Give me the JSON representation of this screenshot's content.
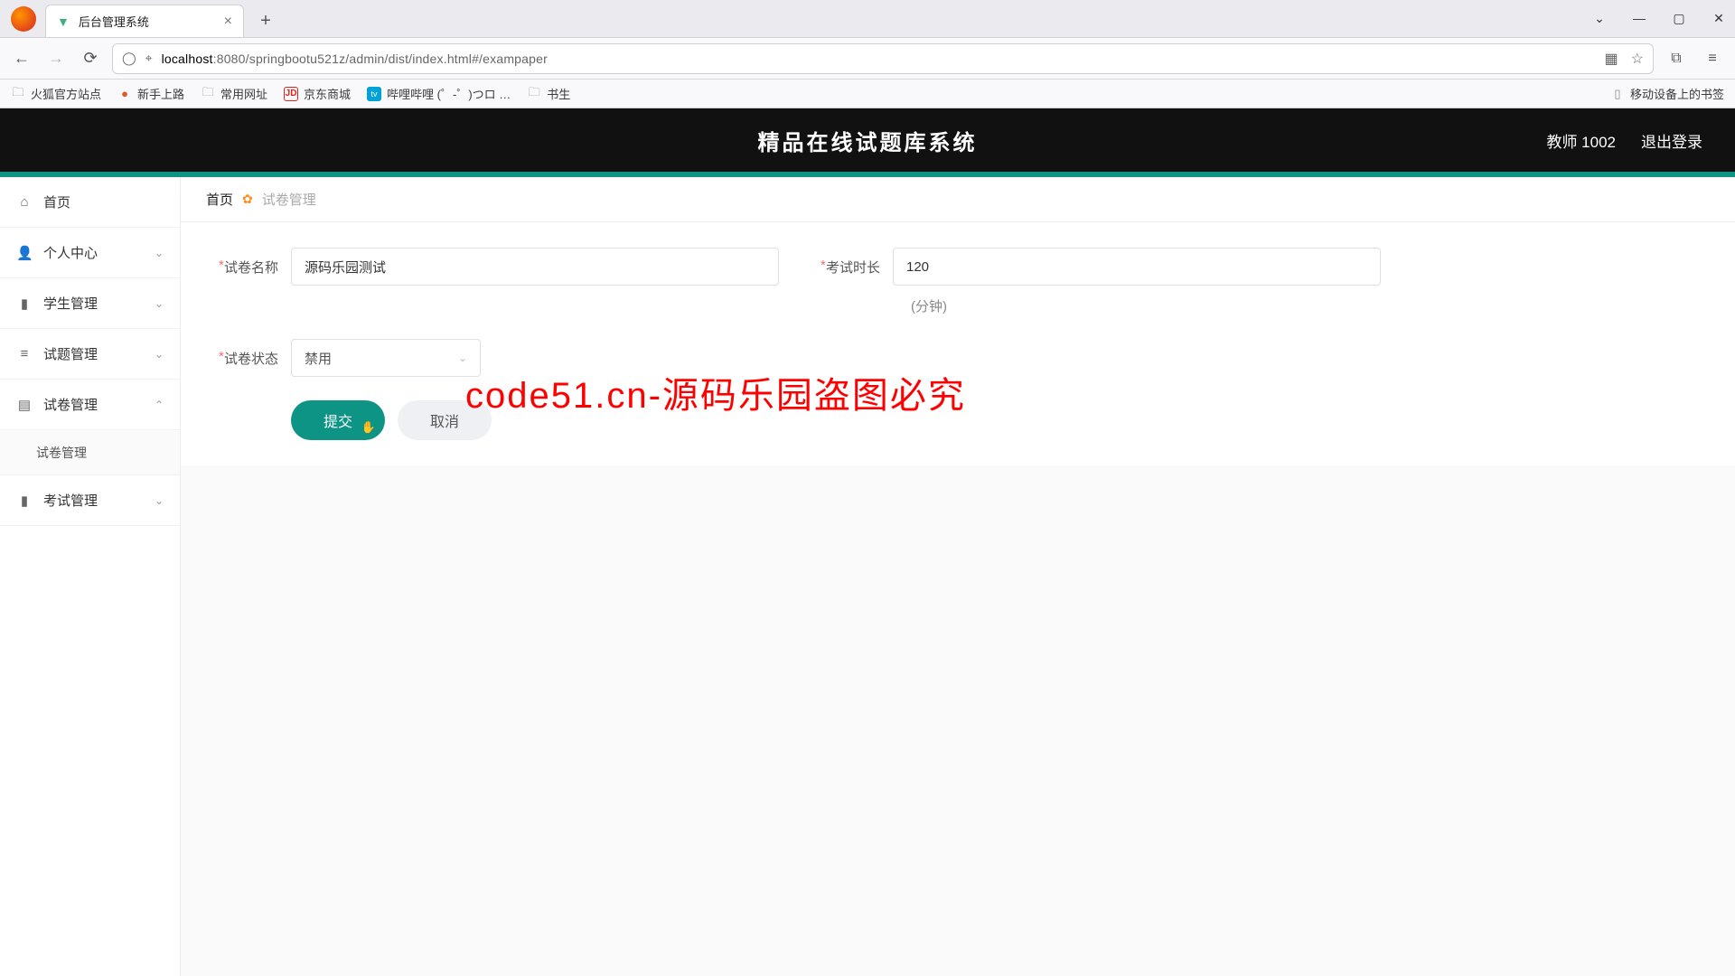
{
  "browser": {
    "tab_title": "后台管理系统",
    "url_host": "localhost",
    "url_rest": ":8080/springbootu521z/admin/dist/index.html#/exampaper",
    "bookmarks": [
      "火狐官方站点",
      "新手上路",
      "常用网址",
      "京东商城",
      "哔哩哔哩 (゜-゜)つロ …",
      "书生"
    ],
    "mobile_bookmarks": "移动设备上的书签"
  },
  "header": {
    "title": "精品在线试题库系统",
    "user": "教师 1002",
    "logout": "退出登录"
  },
  "sidebar": {
    "items": [
      {
        "icon": "⌂",
        "label": "首页",
        "chev": ""
      },
      {
        "icon": "👤",
        "label": "个人中心",
        "chev": "⌄"
      },
      {
        "icon": "▮",
        "label": "学生管理",
        "chev": "⌄"
      },
      {
        "icon": "≡",
        "label": "试题管理",
        "chev": "⌄"
      },
      {
        "icon": "▤",
        "label": "试卷管理",
        "chev": "⌃"
      },
      {
        "icon": "▮",
        "label": "考试管理",
        "chev": "⌄"
      }
    ],
    "sub_exam": "试卷管理"
  },
  "crumb": {
    "home": "首页",
    "current": "试卷管理"
  },
  "form": {
    "name_label": "试卷名称",
    "name_value": "源码乐园测试",
    "duration_label": "考试时长",
    "duration_value": "120",
    "duration_hint": "(分钟)",
    "status_label": "试卷状态",
    "status_value": "禁用",
    "submit": "提交",
    "cancel": "取消"
  },
  "watermark": {
    "text": "code51.cn",
    "big": "code51.cn-源码乐园盗图必究"
  }
}
